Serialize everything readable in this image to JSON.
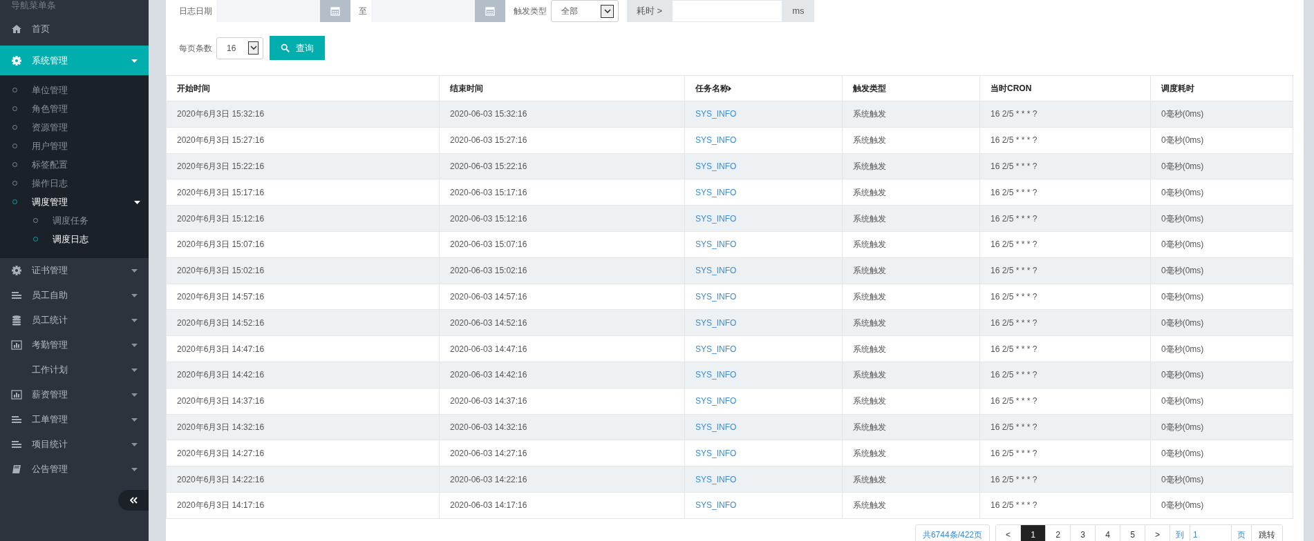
{
  "sidebar": {
    "title": "导航菜单条",
    "items": [
      {
        "label": "首页",
        "selected": false
      },
      {
        "label": "系统管理",
        "selected": true,
        "expanded": true,
        "children": [
          {
            "label": "单位管理",
            "selected": false
          },
          {
            "label": "角色管理",
            "selected": false
          },
          {
            "label": "资源管理",
            "selected": false
          },
          {
            "label": "用户管理",
            "selected": false
          },
          {
            "label": "标签配置",
            "selected": false
          },
          {
            "label": "操作日志",
            "selected": false
          },
          {
            "label": "调度管理",
            "selected": true,
            "expanded": true,
            "children": [
              {
                "label": "调度任务",
                "selected": false
              },
              {
                "label": "调度日志",
                "selected": true
              }
            ]
          }
        ]
      },
      {
        "label": "证书管理",
        "selected": false
      },
      {
        "label": "员工自助",
        "selected": false
      },
      {
        "label": "员工统计",
        "selected": false
      },
      {
        "label": "考勤管理",
        "selected": false
      },
      {
        "label": "工作计划",
        "selected": false
      },
      {
        "label": "薪资管理",
        "selected": false
      },
      {
        "label": "工单管理",
        "selected": false
      },
      {
        "label": "项目统计",
        "selected": false
      },
      {
        "label": "公告管理",
        "selected": false
      }
    ]
  },
  "filters": {
    "date_label": "日志日期",
    "to_label": "至",
    "trigger_label": "触发类型",
    "trigger_value": "全部",
    "duration_prefix": "耗时 >",
    "duration_suffix": "ms",
    "page_size_label": "每页条数",
    "page_size_value": "16",
    "search_button": "查询"
  },
  "table": {
    "columns": [
      {
        "label": "开始时间",
        "sorted": false
      },
      {
        "label": "结束时间",
        "sorted": false
      },
      {
        "label": "任务名称",
        "sorted": true
      },
      {
        "label": "触发类型",
        "sorted": false
      },
      {
        "label": "当时CRON",
        "sorted": false
      },
      {
        "label": "调度耗时",
        "sorted": false
      }
    ],
    "rows": [
      [
        "2020年6月3日 15:32:16",
        "2020-06-03 15:32:16",
        "SYS_INFO",
        "系统触发",
        "16 2/5 * * * ?",
        "0毫秒(0ms)"
      ],
      [
        "2020年6月3日 15:27:16",
        "2020-06-03 15:27:16",
        "SYS_INFO",
        "系统触发",
        "16 2/5 * * * ?",
        "0毫秒(0ms)"
      ],
      [
        "2020年6月3日 15:22:16",
        "2020-06-03 15:22:16",
        "SYS_INFO",
        "系统触发",
        "16 2/5 * * * ?",
        "0毫秒(0ms)"
      ],
      [
        "2020年6月3日 15:17:16",
        "2020-06-03 15:17:16",
        "SYS_INFO",
        "系统触发",
        "16 2/5 * * * ?",
        "0毫秒(0ms)"
      ],
      [
        "2020年6月3日 15:12:16",
        "2020-06-03 15:12:16",
        "SYS_INFO",
        "系统触发",
        "16 2/5 * * * ?",
        "0毫秒(0ms)"
      ],
      [
        "2020年6月3日 15:07:16",
        "2020-06-03 15:07:16",
        "SYS_INFO",
        "系统触发",
        "16 2/5 * * * ?",
        "0毫秒(0ms)"
      ],
      [
        "2020年6月3日 15:02:16",
        "2020-06-03 15:02:16",
        "SYS_INFO",
        "系统触发",
        "16 2/5 * * * ?",
        "0毫秒(0ms)"
      ],
      [
        "2020年6月3日 14:57:16",
        "2020-06-03 14:57:16",
        "SYS_INFO",
        "系统触发",
        "16 2/5 * * * ?",
        "0毫秒(0ms)"
      ],
      [
        "2020年6月3日 14:52:16",
        "2020-06-03 14:52:16",
        "SYS_INFO",
        "系统触发",
        "16 2/5 * * * ?",
        "0毫秒(0ms)"
      ],
      [
        "2020年6月3日 14:47:16",
        "2020-06-03 14:47:16",
        "SYS_INFO",
        "系统触发",
        "16 2/5 * * * ?",
        "0毫秒(0ms)"
      ],
      [
        "2020年6月3日 14:42:16",
        "2020-06-03 14:42:16",
        "SYS_INFO",
        "系统触发",
        "16 2/5 * * * ?",
        "0毫秒(0ms)"
      ],
      [
        "2020年6月3日 14:37:16",
        "2020-06-03 14:37:16",
        "SYS_INFO",
        "系统触发",
        "16 2/5 * * * ?",
        "0毫秒(0ms)"
      ],
      [
        "2020年6月3日 14:32:16",
        "2020-06-03 14:32:16",
        "SYS_INFO",
        "系统触发",
        "16 2/5 * * * ?",
        "0毫秒(0ms)"
      ],
      [
        "2020年6月3日 14:27:16",
        "2020-06-03 14:27:16",
        "SYS_INFO",
        "系统触发",
        "16 2/5 * * * ?",
        "0毫秒(0ms)"
      ],
      [
        "2020年6月3日 14:22:16",
        "2020-06-03 14:22:16",
        "SYS_INFO",
        "系统触发",
        "16 2/5 * * * ?",
        "0毫秒(0ms)"
      ],
      [
        "2020年6月3日 14:17:16",
        "2020-06-03 14:17:16",
        "SYS_INFO",
        "系统触发",
        "16 2/5 * * * ?",
        "0毫秒(0ms)"
      ]
    ]
  },
  "pagination": {
    "summary": "共6744条/422页",
    "prev": "<",
    "pages": [
      {
        "label": "1",
        "selected": true
      },
      {
        "label": "2",
        "selected": false
      },
      {
        "label": "3",
        "selected": false
      },
      {
        "label": "4",
        "selected": false
      },
      {
        "label": "5",
        "selected": false
      }
    ],
    "next": ">",
    "goto_label": "到",
    "goto_value": "1",
    "page_unit": "页",
    "jump_button": "跳转"
  }
}
